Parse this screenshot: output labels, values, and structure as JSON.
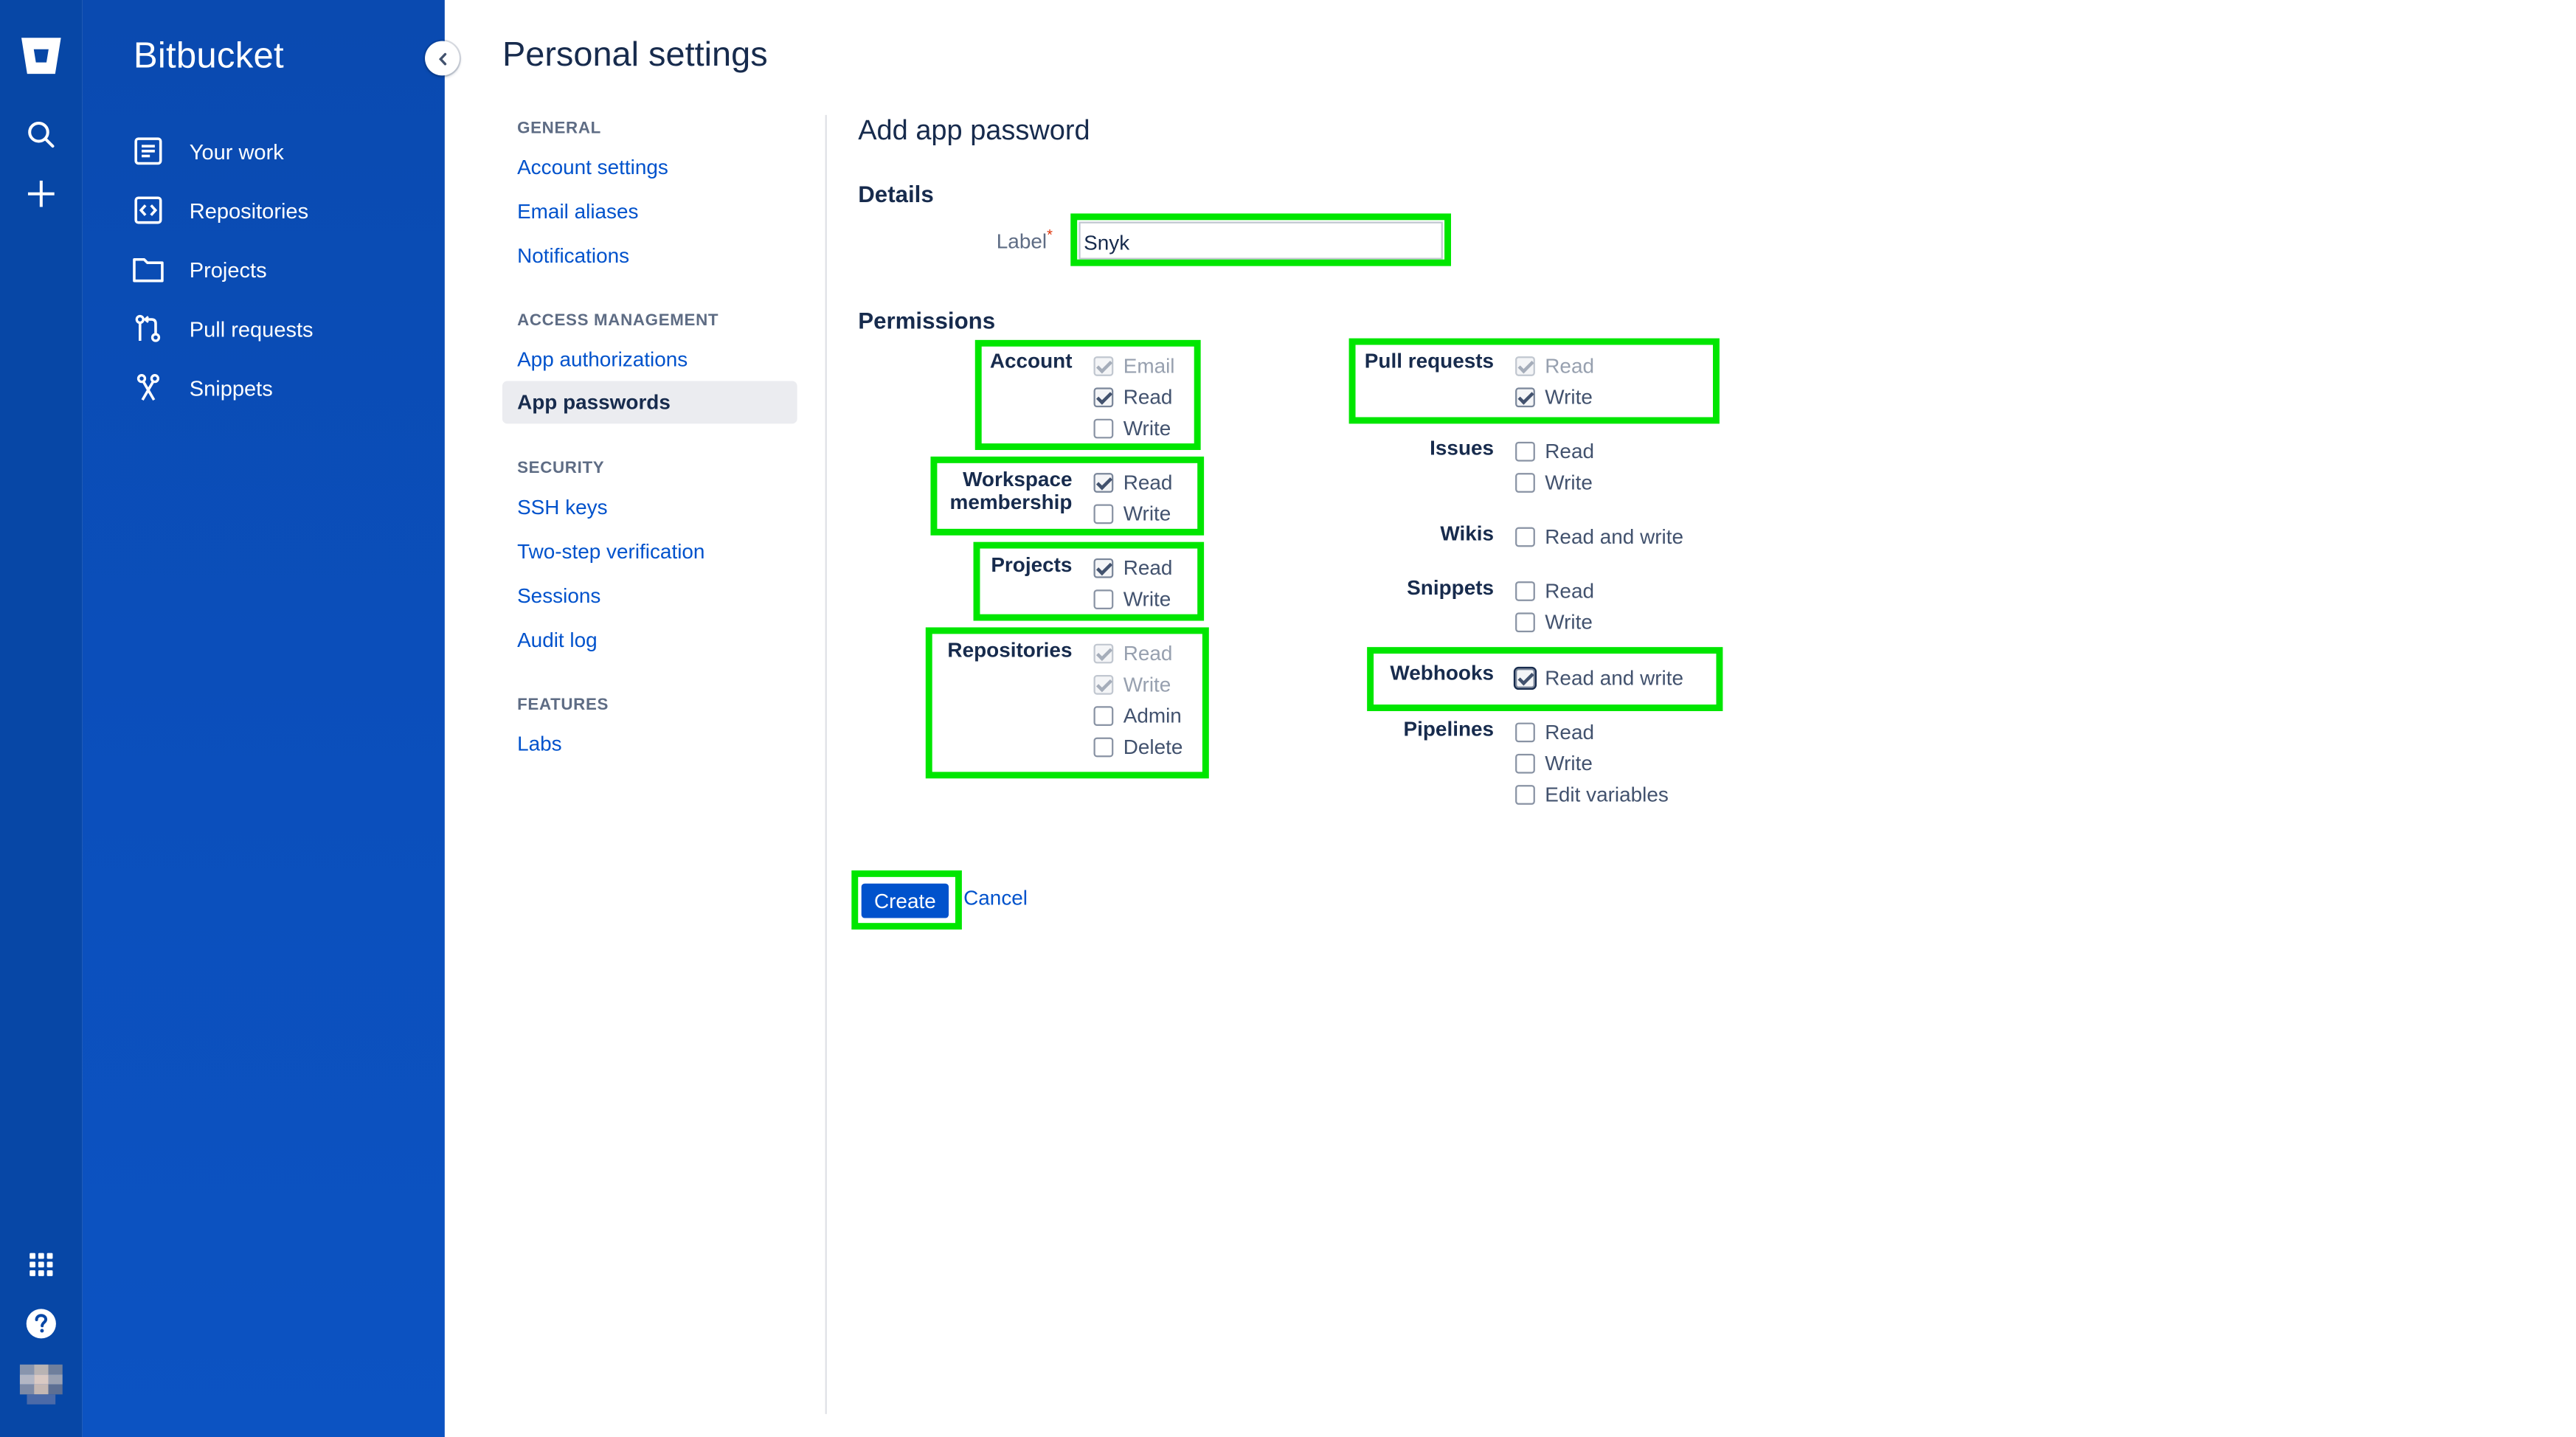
{
  "app": {
    "brand": "Bitbucket"
  },
  "global_nav": {
    "icons": [
      "bitbucket-logo-icon",
      "search-icon",
      "plus-icon",
      "app-switcher-icon",
      "help-icon",
      "avatar"
    ]
  },
  "sidebar": {
    "items": [
      {
        "label": "Your work",
        "icon": "your-work-icon"
      },
      {
        "label": "Repositories",
        "icon": "repositories-icon"
      },
      {
        "label": "Projects",
        "icon": "projects-icon"
      },
      {
        "label": "Pull requests",
        "icon": "pull-requests-icon"
      },
      {
        "label": "Snippets",
        "icon": "snippets-icon"
      }
    ]
  },
  "page_title": "Personal settings",
  "settings_nav": {
    "general": {
      "heading": "GENERAL",
      "links": [
        "Account settings",
        "Email aliases",
        "Notifications"
      ]
    },
    "access": {
      "heading": "ACCESS MANAGEMENT",
      "links": [
        "App authorizations",
        "App passwords"
      ]
    },
    "security": {
      "heading": "SECURITY",
      "links": [
        "SSH keys",
        "Two-step verification",
        "Sessions",
        "Audit log"
      ]
    },
    "features": {
      "heading": "FEATURES",
      "links": [
        "Labs"
      ]
    },
    "active": "App passwords"
  },
  "form": {
    "title": "Add app password",
    "details_heading": "Details",
    "label_field": {
      "label": "Label",
      "value": "Snyk"
    },
    "permissions_heading": "Permissions",
    "groups": {
      "account": {
        "label": "Account",
        "options": [
          {
            "label": "Email",
            "checked": true,
            "disabled": true
          },
          {
            "label": "Read",
            "checked": true,
            "disabled": false
          },
          {
            "label": "Write",
            "checked": false,
            "disabled": false
          }
        ]
      },
      "workspace": {
        "label_line1": "Workspace",
        "label_line2": "membership",
        "options": [
          {
            "label": "Read",
            "checked": true,
            "disabled": false
          },
          {
            "label": "Write",
            "checked": false,
            "disabled": false
          }
        ]
      },
      "projects": {
        "label": "Projects",
        "options": [
          {
            "label": "Read",
            "checked": true,
            "disabled": false
          },
          {
            "label": "Write",
            "checked": false,
            "disabled": false
          }
        ]
      },
      "repositories": {
        "label": "Repositories",
        "options": [
          {
            "label": "Read",
            "checked": true,
            "disabled": true
          },
          {
            "label": "Write",
            "checked": true,
            "disabled": true
          },
          {
            "label": "Admin",
            "checked": false,
            "disabled": false
          },
          {
            "label": "Delete",
            "checked": false,
            "disabled": false
          }
        ]
      },
      "pull_requests": {
        "label": "Pull requests",
        "options": [
          {
            "label": "Read",
            "checked": true,
            "disabled": true
          },
          {
            "label": "Write",
            "checked": true,
            "disabled": false
          }
        ]
      },
      "issues": {
        "label": "Issues",
        "options": [
          {
            "label": "Read",
            "checked": false,
            "disabled": false
          },
          {
            "label": "Write",
            "checked": false,
            "disabled": false
          }
        ]
      },
      "wikis": {
        "label": "Wikis",
        "options": [
          {
            "label": "Read and write",
            "checked": false,
            "disabled": false
          }
        ]
      },
      "snippets": {
        "label": "Snippets",
        "options": [
          {
            "label": "Read",
            "checked": false,
            "disabled": false
          },
          {
            "label": "Write",
            "checked": false,
            "disabled": false
          }
        ]
      },
      "webhooks": {
        "label": "Webhooks",
        "options": [
          {
            "label": "Read and write",
            "checked": true,
            "disabled": false
          }
        ]
      },
      "pipelines": {
        "label": "Pipelines",
        "options": [
          {
            "label": "Read",
            "checked": false,
            "disabled": false
          },
          {
            "label": "Write",
            "checked": false,
            "disabled": false
          },
          {
            "label": "Edit variables",
            "checked": false,
            "disabled": false
          }
        ]
      }
    },
    "create_label": "Create",
    "cancel_label": "Cancel"
  },
  "colors": {
    "sidebar": "#0747a6",
    "link": "#0052cc",
    "highlight": "#00e600",
    "primary_button": "#0052cc"
  }
}
